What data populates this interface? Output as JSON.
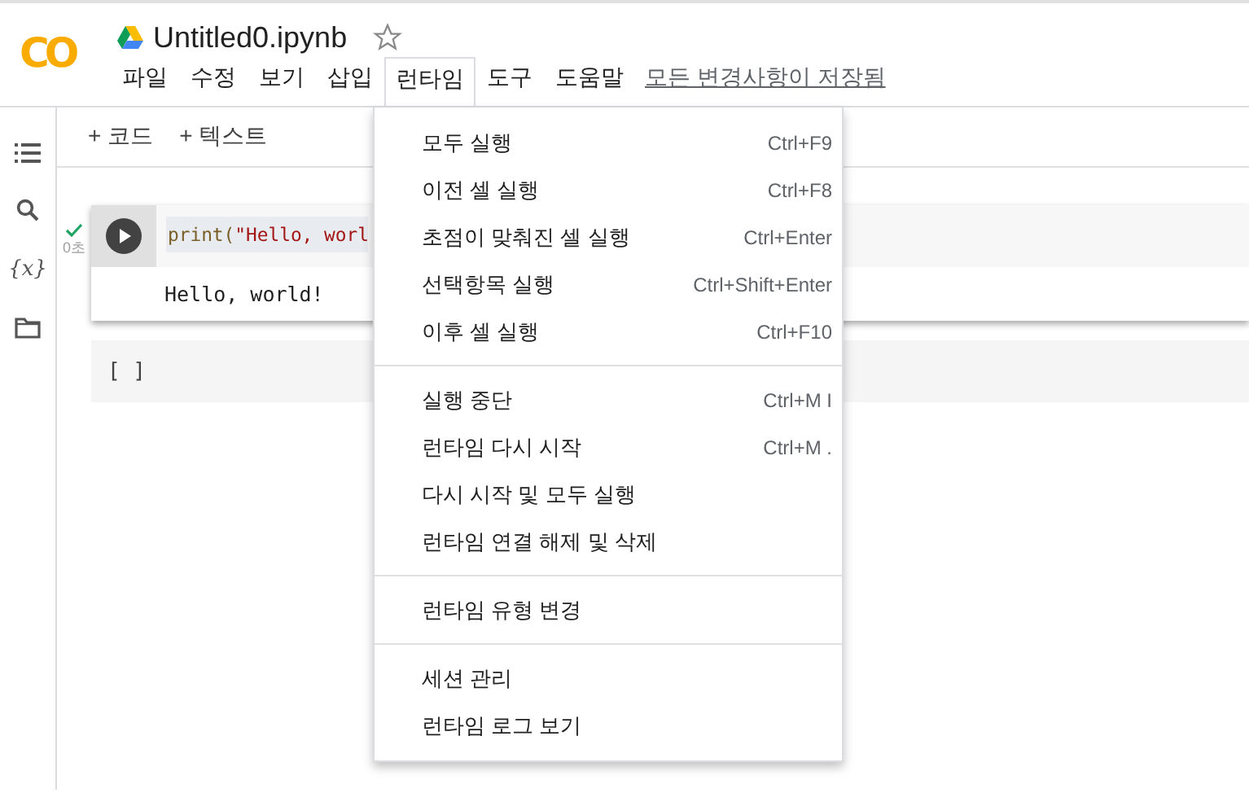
{
  "logo": "CO",
  "title": "Untitled0.ipynb",
  "starred": false,
  "menu": [
    {
      "label": "파일",
      "selected": false
    },
    {
      "label": "수정",
      "selected": false
    },
    {
      "label": "보기",
      "selected": false
    },
    {
      "label": "삽입",
      "selected": false
    },
    {
      "label": "런타임",
      "selected": true
    },
    {
      "label": "도구",
      "selected": false
    },
    {
      "label": "도움말",
      "selected": false
    }
  ],
  "save_status": "모든 변경사항이 저장됨",
  "variables_icon": "{x}",
  "toolbar": [
    "+ 코드",
    "+ 텍스트"
  ],
  "cells": [
    {
      "kind": "code",
      "ran": true,
      "exec_time": "0초",
      "code": [
        {
          "kind": "func",
          "text": "print("
        },
        {
          "kind": "string",
          "text": "\"Hello, worl"
        }
      ],
      "output": "Hello, world!"
    },
    {
      "kind": "empty",
      "prompt": "[ ]"
    }
  ],
  "dropdown": [
    [
      {
        "label": "모두 실행",
        "shortcut": "Ctrl+F9"
      },
      {
        "label": "이전 셀 실행",
        "shortcut": "Ctrl+F8"
      },
      {
        "label": "초점이 맞춰진 셀 실행",
        "shortcut": "Ctrl+Enter"
      },
      {
        "label": "선택항목 실행",
        "shortcut": "Ctrl+Shift+Enter"
      },
      {
        "label": "이후 셀 실행",
        "shortcut": "Ctrl+F10"
      }
    ],
    [
      {
        "label": "실행 중단",
        "shortcut": "Ctrl+M I"
      },
      {
        "label": "런타임 다시 시작",
        "shortcut": "Ctrl+M ."
      },
      {
        "label": "다시 시작 및 모두 실행"
      },
      {
        "label": "런타임 연결 해제 및 삭제"
      }
    ],
    [
      {
        "label": "런타임 유형 변경"
      }
    ],
    [
      {
        "label": "세션 관리"
      },
      {
        "label": "런타임 로그 보기"
      }
    ]
  ]
}
